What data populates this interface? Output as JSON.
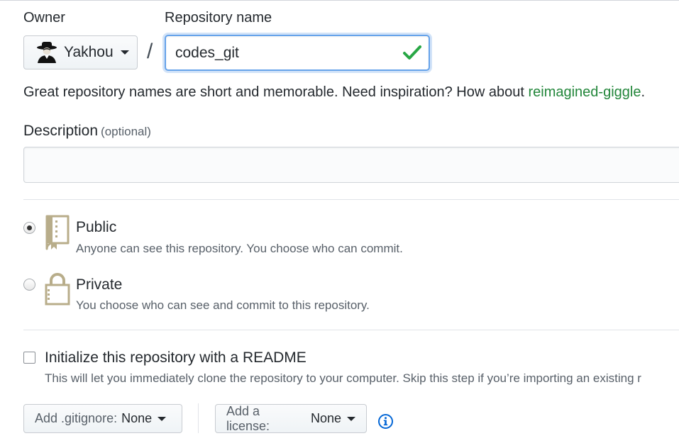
{
  "owner": {
    "label": "Owner",
    "name": "Yakhou"
  },
  "repository": {
    "label": "Repository name",
    "separator": "/",
    "value": "codes_git"
  },
  "hint": {
    "text": "Great repository names are short and memorable. Need inspiration? How about ",
    "suggestion": "reimagined-giggle",
    "suffix": "."
  },
  "description": {
    "label": "Description",
    "optional": "(optional)",
    "value": ""
  },
  "visibility": {
    "selected": "public",
    "public": {
      "title": "Public",
      "desc": "Anyone can see this repository. You choose who can commit."
    },
    "private": {
      "title": "Private",
      "desc": "You choose who can see and commit to this repository."
    }
  },
  "init": {
    "checked": false,
    "title": "Initialize this repository with a README",
    "desc": "This will let you immediately clone the repository to your computer. Skip this step if you’re importing an existing r"
  },
  "gitignore": {
    "label": "Add .gitignore:",
    "value": "None"
  },
  "license": {
    "label": "Add a license:",
    "value": "None"
  },
  "icons": {
    "check": "check-icon",
    "repo": "repo-book-icon",
    "lock": "lock-icon",
    "info": "info-icon",
    "caret": "caret-down-icon"
  },
  "colors": {
    "success": "#28a745",
    "link_green": "#22863a",
    "focus_blue": "#66a3ea",
    "info_blue": "#0366d6",
    "icon_tan": "#b8ad8a"
  }
}
